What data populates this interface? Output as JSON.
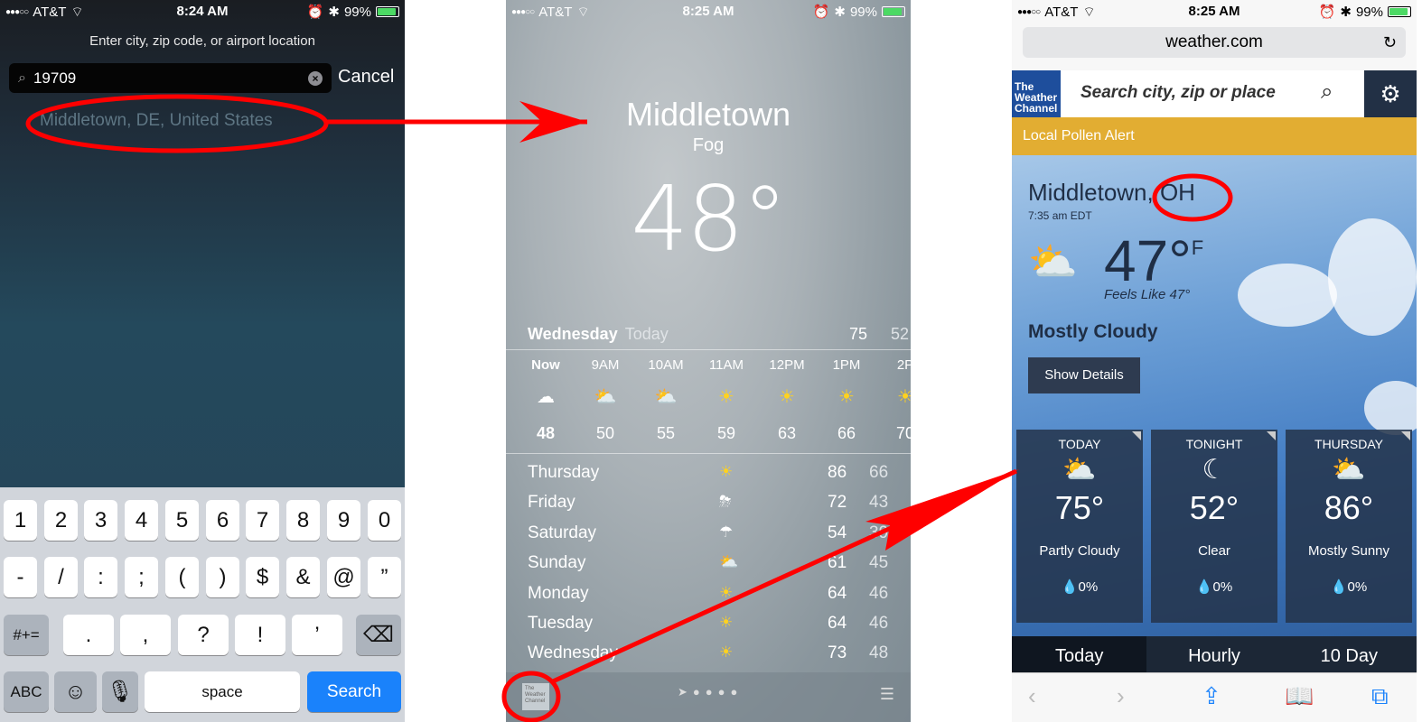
{
  "panel1": {
    "status": {
      "carrier": "AT&T",
      "time": "8:24 AM",
      "battery": "99%"
    },
    "hint": "Enter city, zip code, or airport location",
    "search_value": "19709",
    "cancel": "Cancel",
    "result": "Middletown, DE, United States",
    "keyboard": {
      "row1": [
        "1",
        "2",
        "3",
        "4",
        "5",
        "6",
        "7",
        "8",
        "9",
        "0"
      ],
      "row2": [
        "-",
        "/",
        ":",
        ";",
        "(",
        ")",
        "$",
        "&",
        "@",
        "”"
      ],
      "row3_mode": "#+=",
      "row3": [
        ".",
        ",",
        "?",
        "!",
        "’"
      ],
      "abc": "ABC",
      "space": "space",
      "search": "Search"
    }
  },
  "panel2": {
    "status": {
      "carrier": "AT&T",
      "time": "8:25 AM",
      "battery": "99%"
    },
    "city": "Middletown",
    "condition": "Fog",
    "temp": "48°",
    "day_name": "Wednesday",
    "day_label": "Today",
    "day_hi": "75",
    "day_lo": "52",
    "hourly": [
      {
        "h": "Now",
        "icon": "fog-icon",
        "t": "48"
      },
      {
        "h": "9AM",
        "icon": "partly-sunny-icon",
        "t": "50"
      },
      {
        "h": "10AM",
        "icon": "partly-sunny-icon",
        "t": "55"
      },
      {
        "h": "11AM",
        "icon": "sun-icon",
        "t": "59"
      },
      {
        "h": "12PM",
        "icon": "sun-icon",
        "t": "63"
      },
      {
        "h": "1PM",
        "icon": "sun-icon",
        "t": "66"
      },
      {
        "h": "2P",
        "icon": "sun-icon",
        "t": "70"
      }
    ],
    "daily": [
      {
        "d": "Thursday",
        "icon": "sun-icon",
        "hi": "86",
        "lo": "66"
      },
      {
        "d": "Friday",
        "icon": "thunderstorm-icon",
        "hi": "72",
        "lo": "43"
      },
      {
        "d": "Saturday",
        "icon": "rain-icon",
        "hi": "54",
        "lo": "39"
      },
      {
        "d": "Sunday",
        "icon": "partly-sunny-icon",
        "hi": "61",
        "lo": "45"
      },
      {
        "d": "Monday",
        "icon": "sun-icon",
        "hi": "64",
        "lo": "46"
      },
      {
        "d": "Tuesday",
        "icon": "sun-icon",
        "hi": "64",
        "lo": "46"
      },
      {
        "d": "Wednesday",
        "icon": "sun-icon",
        "hi": "73",
        "lo": "48"
      }
    ],
    "twc_logo": "The Weather Channel"
  },
  "panel3": {
    "status": {
      "carrier": "AT&T",
      "time": "8:25 AM",
      "battery": "99%"
    },
    "url": "weather.com",
    "logo": "The Weather Channel",
    "search_placeholder": "Search city, zip or place",
    "pollen": "Local Pollen Alert",
    "location": "Middletown, OH",
    "local_time": "7:35 am EDT",
    "temp": "47°",
    "unit": "F",
    "feels": "Feels Like 47°",
    "condition": "Mostly Cloudy",
    "show_details": "Show Details",
    "cards": [
      {
        "label": "TODAY",
        "icon": "partly-cloudy-icon",
        "temp": "75°",
        "desc": "Partly Cloudy",
        "precip": "0%"
      },
      {
        "label": "TONIGHT",
        "icon": "moon-icon",
        "temp": "52°",
        "desc": "Clear",
        "precip": "0%"
      },
      {
        "label": "THURSDAY",
        "icon": "partly-cloudy-icon",
        "temp": "86°",
        "desc": "Mostly Sunny",
        "precip": "0%"
      }
    ],
    "tabs": [
      "Today",
      "Hourly",
      "10 Day"
    ]
  },
  "colors": {
    "annotation": "#ff0000",
    "twc_blue": "#1e4e9c",
    "pollen": "#e2ad32",
    "ios_blue": "#1a82fb"
  }
}
